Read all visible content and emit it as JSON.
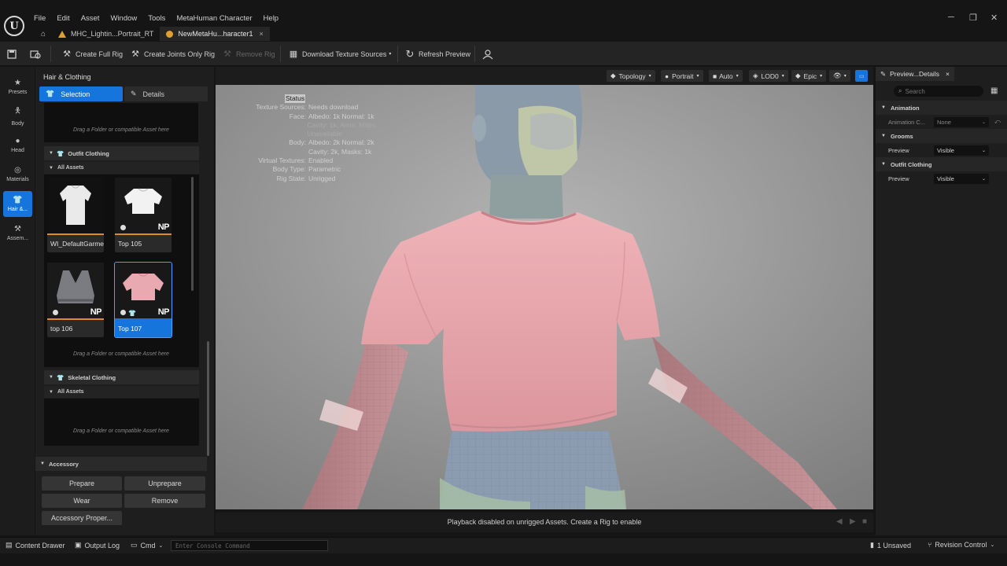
{
  "menu": [
    "File",
    "Edit",
    "Asset",
    "Window",
    "Tools",
    "MetaHuman Character",
    "Help"
  ],
  "tabs": [
    {
      "label": "MHC_Lightin...Portrait_RT"
    },
    {
      "label": "NewMetaHu...haracter1",
      "close": "×"
    }
  ],
  "window": {
    "minimize": "─",
    "restore": "❐",
    "close": "✕"
  },
  "toolbar": {
    "create_full_rig": "Create Full Rig",
    "create_joints_only_rig": "Create Joints Only Rig",
    "remove_rig": "Remove Rig",
    "download_texture_sources": "Download Texture Sources",
    "refresh_preview": "Refresh Preview"
  },
  "rail": [
    {
      "label": "Presets"
    },
    {
      "label": "Body"
    },
    {
      "label": "Head"
    },
    {
      "label": "Materials"
    },
    {
      "label": "Hair &..."
    },
    {
      "label": "Assem..."
    }
  ],
  "left_panel": {
    "title": "Hair & Clothing",
    "selection_tab": "Selection",
    "details_tab": "Details",
    "drop_hint": "Drag a Folder or compatible Asset here",
    "outfit_clothing": "Outfit Clothing",
    "all_assets": "All Assets",
    "assets": [
      {
        "label": "WI_DefaultGarment"
      },
      {
        "label": "Top 105",
        "badge": "NP"
      },
      {
        "label": "top 106",
        "badge": "NP"
      },
      {
        "label": "Top 107",
        "badge": "NP"
      }
    ],
    "skeletal_clothing": "Skeletal Clothing",
    "accessory": "Accessory",
    "buttons": {
      "prepare": "Prepare",
      "unprepare": "Unprepare",
      "wear": "Wear",
      "remove": "Remove",
      "accessory_properties": "Accessory Proper..."
    }
  },
  "viewport": {
    "topology": "Topology",
    "portrait": "Portrait",
    "auto": "Auto",
    "lod": "LOD0",
    "epic": "Epic",
    "status_title": "Status",
    "status": [
      {
        "k": "Texture Sources:",
        "v": "Needs download"
      },
      {
        "k": "Face:",
        "v": "Albedo: 1k Normal: 1k"
      },
      {
        "k": "",
        "v": "Cavity: 1k, Anim. Maps: Unavailable",
        "dim": true
      },
      {
        "k": "Body:",
        "v": "Albedo: 2k Normal: 2k"
      },
      {
        "k": "",
        "v": "Cavity: 2k, Masks: 1k"
      },
      {
        "k": "Virtual Textures:",
        "v": "Enabled"
      },
      {
        "k": "Body Type:",
        "v": "Parametric"
      },
      {
        "k": "Rig State:",
        "v": "Unrigged"
      }
    ],
    "playback": "Playback disabled on unrigged Assets. Create a Rig to enable"
  },
  "details": {
    "tab": "Preview...Details",
    "close": "×",
    "search_placeholder": "Search",
    "animation": "Animation",
    "animation_c": "Animation C...",
    "animation_value": "None",
    "grooms": "Grooms",
    "preview": "Preview",
    "grooms_value": "Visible",
    "outfit_clothing": "Outfit Clothing",
    "outfit_value": "Visible"
  },
  "statusbar": {
    "content_drawer": "Content Drawer",
    "output_log": "Output Log",
    "cmd": "Cmd",
    "console_placeholder": "Enter Console Command",
    "unsaved": "1 Unsaved",
    "revision_control": "Revision Control"
  },
  "colors": {
    "accent": "#1675dd",
    "asset_bar": "#e08a2a",
    "shirt": "#e9a9ae"
  }
}
